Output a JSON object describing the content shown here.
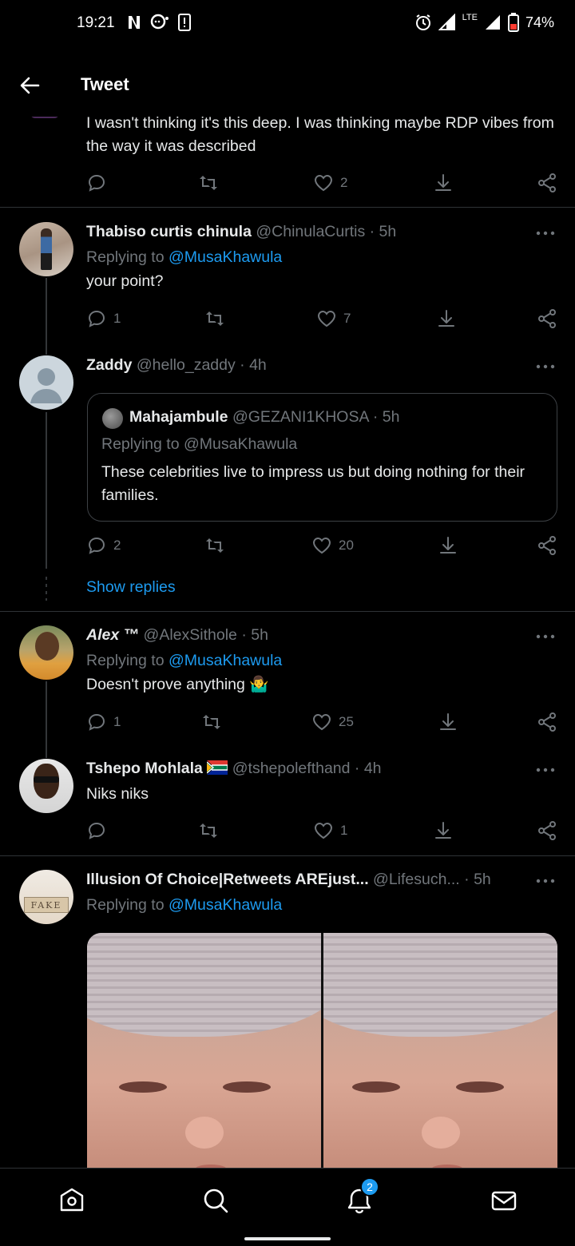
{
  "status_bar": {
    "time": "19:21",
    "battery": "74%",
    "network": "LTE"
  },
  "header": {
    "title": "Tweet"
  },
  "tweets": [
    {
      "text": "I wasn't thinking it's this deep. I was thinking maybe RDP vibes from the way it was described",
      "replies": "",
      "retweets": "",
      "likes": "2"
    },
    {
      "name": "Thabiso curtis chinula",
      "handle": "@ChinulaCurtis",
      "time": "· 5h",
      "replying_label": "Replying to",
      "replying_to": "@MusaKhawula",
      "text": "your point?",
      "replies": "1",
      "retweets": "",
      "likes": "7"
    },
    {
      "name": "Zaddy",
      "handle": "@hello_zaddy",
      "time": "· 4h",
      "quote": {
        "name": "Mahajambule",
        "handle": "@GEZANI1KHOSA",
        "time": "· 5h",
        "replying": "Replying to @MusaKhawula",
        "text": "These celebrities live to impress us but doing nothing for their families."
      },
      "replies": "2",
      "retweets": "",
      "likes": "20",
      "show_replies": "Show replies"
    },
    {
      "name": "Alex ™",
      "handle": "@AlexSithole",
      "time": "· 5h",
      "replying_label": "Replying to",
      "replying_to": "@MusaKhawula",
      "text": "Doesn't prove anything 🤷‍♂️",
      "replies": "1",
      "retweets": "",
      "likes": "25"
    },
    {
      "name": "Tshepo Mohlala",
      "handle": "@tshepolefthand",
      "time": "· 4h",
      "text": "Niks niks",
      "replies": "",
      "retweets": "",
      "likes": "1"
    },
    {
      "name": "Illusion Of Choice|Retweets AREjust...",
      "handle": "@Lifesuch...",
      "time": "· 5h",
      "replying_label": "Replying to",
      "replying_to": "@MusaKhawula"
    }
  ],
  "avatar_text": "FAKE",
  "bottom_nav": {
    "notifications_badge": "2"
  },
  "colors": {
    "accent": "#1d9bf0",
    "muted": "#71767b",
    "background": "#000000",
    "divider": "#2f3336"
  },
  "icons": [
    "back-arrow-icon",
    "reply-icon",
    "retweet-icon",
    "like-icon",
    "share-icon",
    "more-icon",
    "home-icon",
    "search-icon",
    "bell-icon",
    "mail-icon"
  ]
}
